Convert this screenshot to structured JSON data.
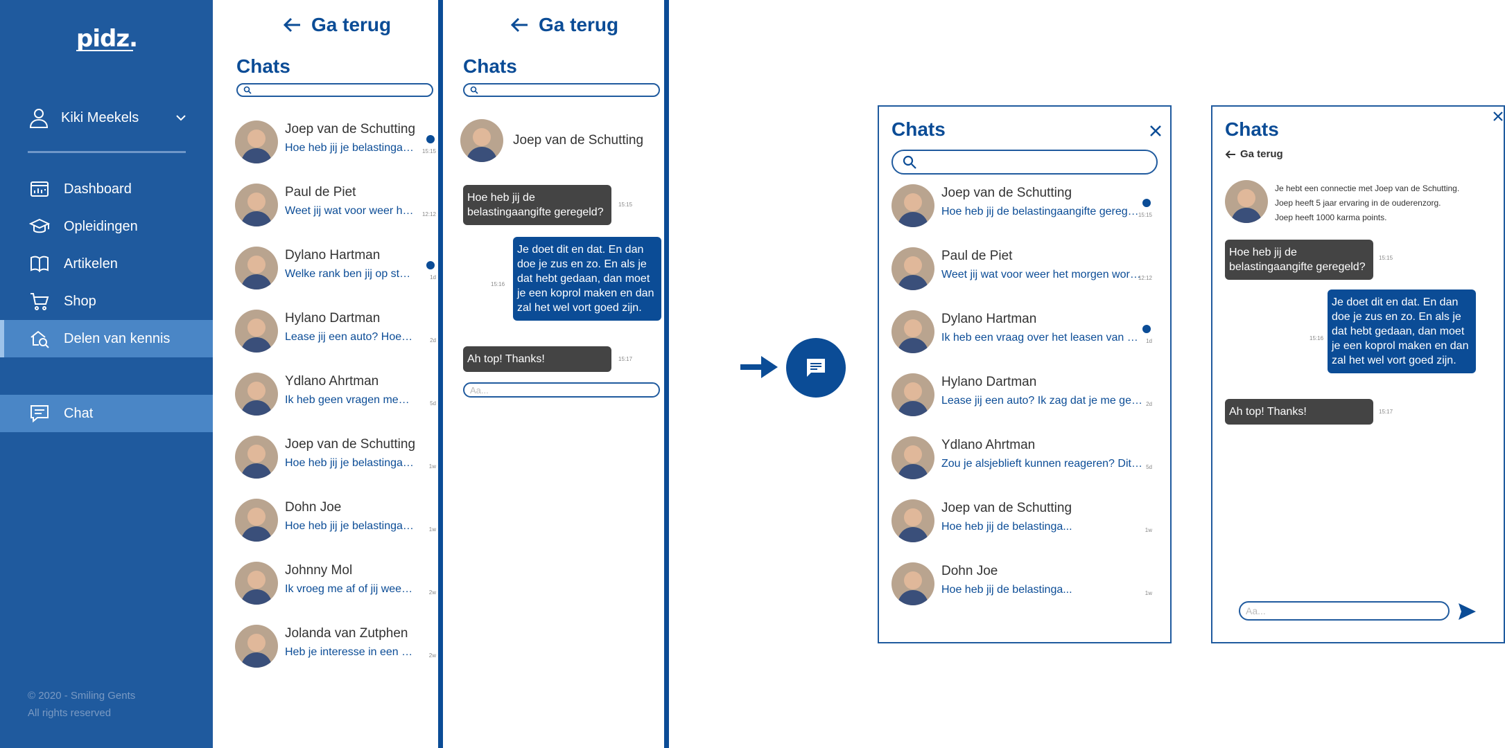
{
  "brand": {
    "logo": "pidz."
  },
  "colors": {
    "primary": "#0b4c96",
    "sidebar": "#1f5a9e",
    "active": "#4a86c6",
    "bubble_in": "#444444",
    "bubble_out": "#0b4c96"
  },
  "sidebar": {
    "user_name": "Kiki Meekels",
    "nav": [
      {
        "label": "Dashboard",
        "icon": "dashboard-icon"
      },
      {
        "label": "Opleidingen",
        "icon": "graduation-cap-icon"
      },
      {
        "label": "Artikelen",
        "icon": "book-icon"
      },
      {
        "label": "Shop",
        "icon": "shopping-cart-icon"
      },
      {
        "label": "Delen van kennis",
        "icon": "knowledge-search-icon"
      }
    ],
    "chat_label": "Chat",
    "footer_line1": "© 2020 - Smiling Gents",
    "footer_line2": "All rights reserved"
  },
  "mobile_list": {
    "back_label": "Ga terug",
    "title": "Chats",
    "items": [
      {
        "name": "Joep van de Schutting",
        "preview": "Hoe heb jij je belastingaangifte geregeld?",
        "time": "15:15",
        "unread": true
      },
      {
        "name": "Paul de Piet",
        "preview": "Weet jij wat voor weer het morgen wordt?",
        "time": "12:12",
        "unread": false
      },
      {
        "name": "Dylano Hartman",
        "preview": "Welke rank ben jij op starcraft?",
        "time": "1d",
        "unread": true
      },
      {
        "name": "Hylano Dartman",
        "preview": "Lease jij een auto? Hoe vind je dat?",
        "time": "2d",
        "unread": false
      },
      {
        "name": "Ydlano Ahrtman",
        "preview": "Ik heb geen vragen meer, bedankt!",
        "time": "5d",
        "unread": false
      },
      {
        "name": "Joep van de Schutting",
        "preview": "Hoe heb jij je belastingaangifte geregeld?",
        "time": "1w",
        "unread": false
      },
      {
        "name": "Dohn Joe",
        "preview": "Hoe heb jij je belastingaangifte geregeld?",
        "time": "1w",
        "unread": false
      },
      {
        "name": "Johnny Mol",
        "preview": "Ik vroeg me af of jij weet hoe dat werkt",
        "time": "2w",
        "unread": false
      },
      {
        "name": "Jolanda van Zutphen",
        "preview": "Heb je interesse in een six-pack?",
        "time": "2w",
        "unread": false
      }
    ]
  },
  "mobile_conv": {
    "back_label": "Ga terug",
    "title": "Chats",
    "contact": "Joep van de Schutting",
    "messages": [
      {
        "dir": "in",
        "text": "Hoe heb jij de belastingaangifte geregeld?",
        "time": "15:15"
      },
      {
        "dir": "out",
        "text": "Je doet dit en dat. En dan doe je zus en zo. En als je dat hebt gedaan, dan moet je een koprol maken en dan zal het wel vort goed zijn.",
        "time": "15:16"
      },
      {
        "dir": "in",
        "text": "Ah top! Thanks!",
        "time": "15:17"
      }
    ],
    "input_placeholder": "Aa..."
  },
  "popup_list": {
    "title": "Chats",
    "items": [
      {
        "name": "Joep van de Schutting",
        "preview": "Hoe heb jij de belastingaangifte geregeld?",
        "time": "15:15",
        "unread": true
      },
      {
        "name": "Paul de Piet",
        "preview": "Weet jij wat voor weer het morgen wordt?",
        "time": "12:12",
        "unread": false
      },
      {
        "name": "Dylano Hartman",
        "preview": "Ik heb een vraag over het leasen van een auto",
        "time": "1d",
        "unread": true
      },
      {
        "name": "Hylano Dartman",
        "preview": "Lease jij een auto? Ik zag dat je me gebeld had",
        "time": "2d",
        "unread": false
      },
      {
        "name": "Ydlano Ahrtman",
        "preview": "Zou je alsjeblieft kunnen reageren? Dit is belangrijk",
        "time": "5d",
        "unread": false
      },
      {
        "name": "Joep van de Schutting",
        "preview": "Hoe heb jij de belastinga...",
        "time": "1w",
        "unread": false
      },
      {
        "name": "Dohn Joe",
        "preview": "Hoe heb jij de belastinga...",
        "time": "1w",
        "unread": false
      }
    ]
  },
  "popup_conv": {
    "title": "Chats",
    "back_label": "Ga terug",
    "info_line1": "Je hebt een connectie met Joep van de Schutting.",
    "info_line2": "Joep heeft 5 jaar ervaring in de ouderenzorg.",
    "info_line3": "Joep heeft 1000 karma points.",
    "messages": [
      {
        "dir": "in",
        "text": "Hoe heb jij de belastingaangifte geregeld?",
        "time": "15:15"
      },
      {
        "dir": "out",
        "text": "Je doet dit en dat. En dan doe je zus en zo. En als je dat hebt gedaan, dan moet je een koprol maken en dan zal het wel vort goed zijn.",
        "time": "15:16"
      },
      {
        "dir": "in",
        "text": "Ah top! Thanks!",
        "time": "15:17"
      }
    ],
    "input_placeholder": "Aa..."
  }
}
